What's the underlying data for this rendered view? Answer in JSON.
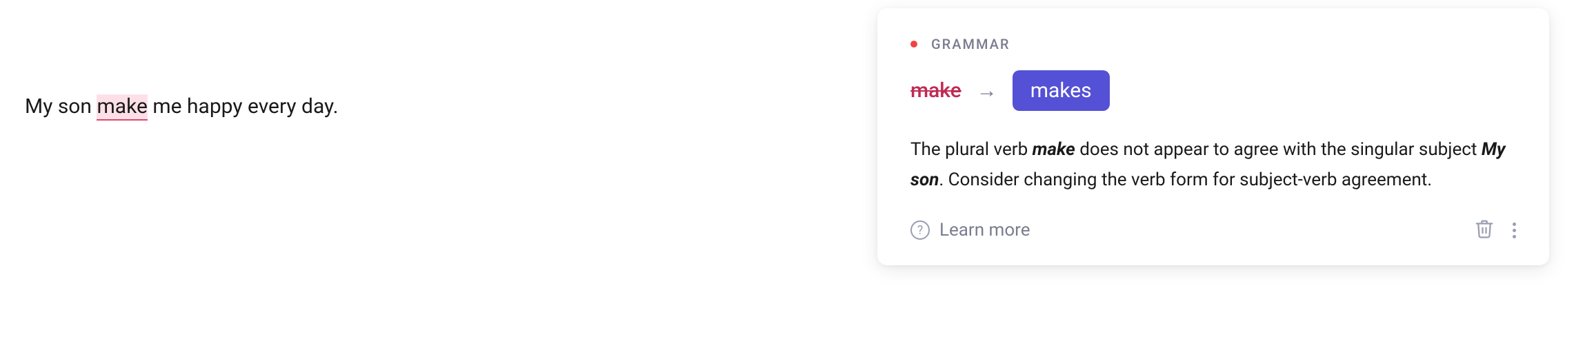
{
  "editor": {
    "before": "My son ",
    "error_word": "make",
    "after": " me happy every day."
  },
  "card": {
    "category": "GRAMMAR",
    "original": "make",
    "replacement": "makes",
    "explanation_parts": {
      "p1": "The plural verb ",
      "b1": "make",
      "p2": " does not appear to agree with the singular subject ",
      "b2": "My son",
      "p3": ". Consider changing the verb form for subject-verb agreement."
    },
    "learn_more": "Learn more"
  }
}
